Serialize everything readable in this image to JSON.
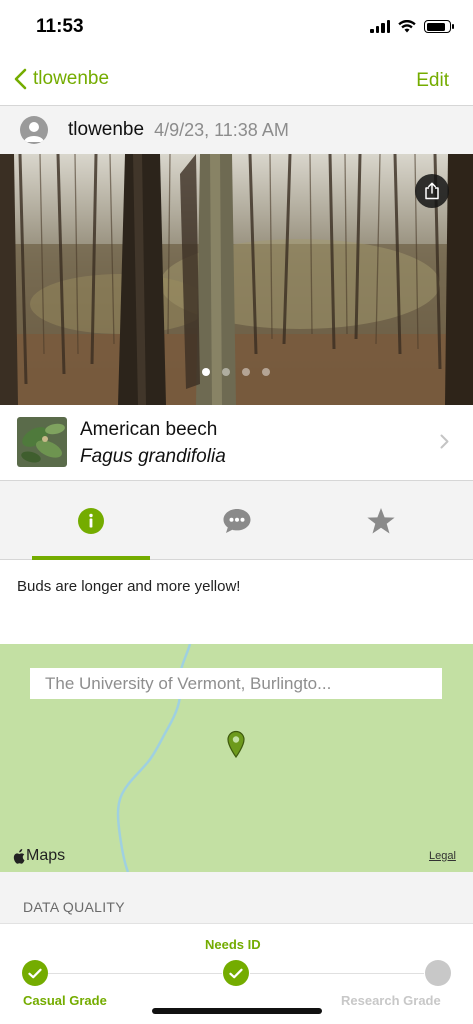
{
  "status_bar": {
    "time": "11:53"
  },
  "nav": {
    "back_label": "tlowenbe",
    "edit_label": "Edit"
  },
  "observation": {
    "user": "tlowenbe",
    "date": "4/9/23, 11:38 AM"
  },
  "photo": {
    "photo_count": 4,
    "active_index": 0
  },
  "taxon": {
    "common_name": "American beech",
    "scientific_name": "Fagus grandifolia"
  },
  "tabs": [
    {
      "name": "info",
      "icon": "info-icon",
      "active": true
    },
    {
      "name": "activity",
      "icon": "speech-bubble-icon",
      "active": false
    },
    {
      "name": "favorites",
      "icon": "star-icon",
      "active": false
    }
  ],
  "description": "Buds are longer and more yellow!",
  "map": {
    "place": "The University of Vermont, Burlingto...",
    "provider": "Maps",
    "legal": "Legal"
  },
  "data_quality": {
    "header": "DATA QUALITY",
    "needs_id": "Needs ID",
    "casual_grade": "Casual Grade",
    "research_grade": "Research Grade"
  },
  "colors": {
    "accent": "#74ac00",
    "inactive": "#c8c8c8"
  }
}
